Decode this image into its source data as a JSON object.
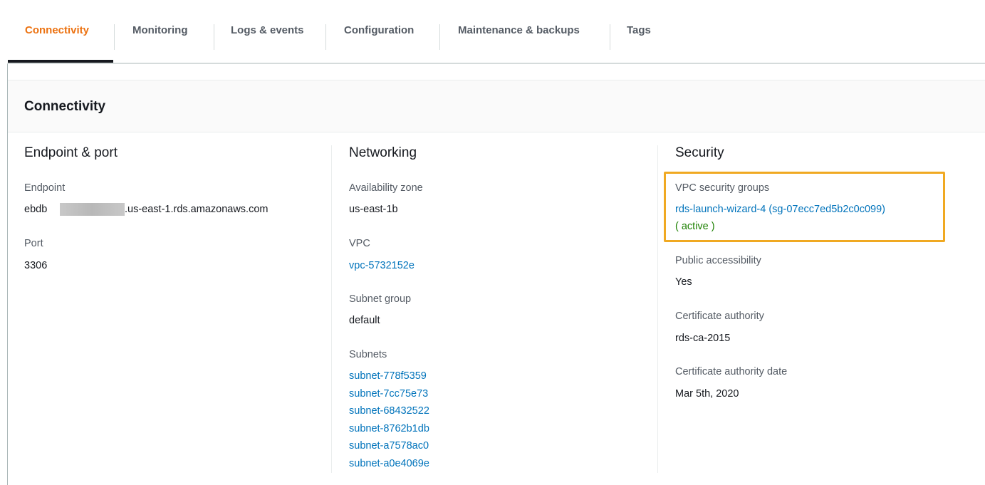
{
  "tabs": [
    {
      "label": "Connectivity",
      "active": true
    },
    {
      "label": "Monitoring"
    },
    {
      "label": "Logs & events"
    },
    {
      "label": "Configuration"
    },
    {
      "label": "Maintenance & backups"
    },
    {
      "label": "Tags"
    }
  ],
  "panel": {
    "title": "Connectivity"
  },
  "endpoint_section": {
    "title": "Endpoint & port",
    "endpoint_label": "Endpoint",
    "endpoint_prefix": "ebdb",
    "endpoint_suffix": ".us-east-1.rds.amazonaws.com",
    "port_label": "Port",
    "port_value": "3306"
  },
  "networking_section": {
    "title": "Networking",
    "az_label": "Availability zone",
    "az_value": "us-east-1b",
    "vpc_label": "VPC",
    "vpc_value": "vpc-5732152e",
    "subnet_group_label": "Subnet group",
    "subnet_group_value": "default",
    "subnets_label": "Subnets",
    "subnets": [
      "subnet-778f5359",
      "subnet-7cc75e73",
      "subnet-68432522",
      "subnet-8762b1db",
      "subnet-a7578ac0",
      "subnet-a0e4069e"
    ]
  },
  "security_section": {
    "title": "Security",
    "vpc_sg_label": "VPC security groups",
    "vpc_sg_value": "rds-launch-wizard-4 (sg-07ecc7ed5b2c0c099)",
    "vpc_sg_status": "( active )",
    "public_access_label": "Public accessibility",
    "public_access_value": "Yes",
    "ca_label": "Certificate authority",
    "ca_value": "rds-ca-2015",
    "ca_date_label": "Certificate authority date",
    "ca_date_value": "Mar 5th, 2020"
  },
  "colors": {
    "active_tab": "#ec7211",
    "link": "#0073bb",
    "status_active": "#1d8102",
    "highlight": "#f0a922"
  }
}
